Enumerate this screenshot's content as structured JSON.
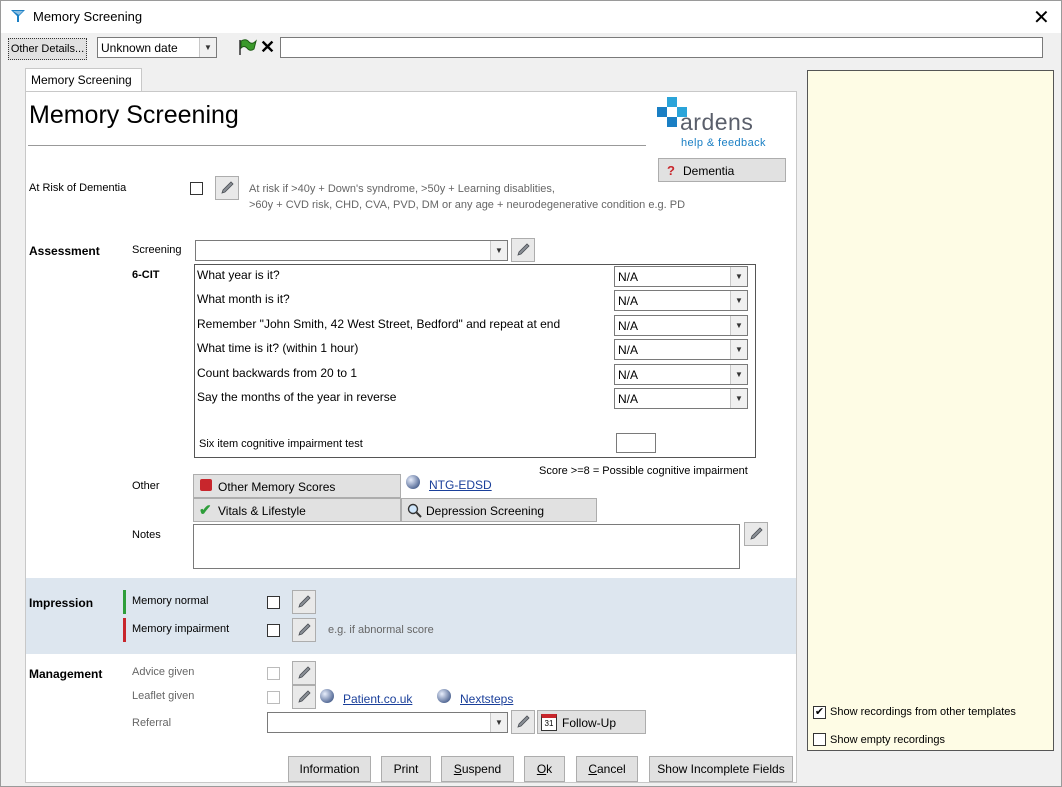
{
  "window": {
    "title": "Memory Screening",
    "close_glyph": "✕"
  },
  "toolbar": {
    "other_details_label": "Other Details...",
    "date_value": "Unknown date",
    "search_value": ""
  },
  "tab": {
    "label": "Memory Screening"
  },
  "heading": "Memory Screening",
  "brand": {
    "name": "ardens",
    "subtitle": "help & feedback",
    "dementia_button": "Dementia"
  },
  "risk": {
    "label": "At Risk of Dementia",
    "hint_line1": "At risk if >40y + Down's syndrome, >50y + Learning disablities,",
    "hint_line2": ">60y + CVD risk, CHD, CVA, PVD, DM or any age + neurodegenerative condition e.g. PD"
  },
  "assessment": {
    "section_label": "Assessment",
    "screening_label": "Screening",
    "screening_value": "",
    "cit_label": "6-CIT",
    "questions": [
      {
        "text": "What year is it?",
        "value": "N/A"
      },
      {
        "text": "What month is it?",
        "value": "N/A"
      },
      {
        "text": "Remember \"John Smith, 42 West Street, Bedford\" and repeat at end",
        "value": "N/A"
      },
      {
        "text": "What time is it? (within 1 hour)",
        "value": "N/A"
      },
      {
        "text": "Count backwards from 20 to 1",
        "value": "N/A"
      },
      {
        "text": "Say the months of the year in reverse",
        "value": "N/A"
      }
    ],
    "total_label": "Six item cognitive impairment test",
    "total_value": "",
    "score_note": "Score >=8   = Possible cognitive impairment",
    "other_label": "Other",
    "other_memory_scores": "Other Memory Scores",
    "ntg_link": "NTG-EDSD",
    "vitals_lifestyle": "Vitals & Lifestyle",
    "depression_screening": "Depression Screening",
    "notes_label": "Notes",
    "notes_value": ""
  },
  "impression": {
    "section_label": "Impression",
    "memory_normal": "Memory normal",
    "memory_impairment": "Memory impairment",
    "impairment_hint": "e.g. if abnormal score",
    "normal_color": "#2e9e3a",
    "impairment_color": "#c8262c"
  },
  "management": {
    "section_label": "Management",
    "advice_given": "Advice given",
    "leaflet_given": "Leaflet given",
    "patient_link": "Patient.co.uk",
    "nextsteps_link": "Nextsteps",
    "referral_label": "Referral",
    "referral_value": "",
    "follow_up": "Follow-Up",
    "calendar_day": "31"
  },
  "right_panel": {
    "show_other_templates": "Show recordings from other templates",
    "show_other_templates_checked": true,
    "show_empty": "Show empty recordings",
    "show_empty_checked": false
  },
  "footer": {
    "information": "Information",
    "print": "Print",
    "suspend": "Suspend",
    "ok": "Ok",
    "cancel": "Cancel",
    "show_incomplete": "Show Incomplete Fields"
  },
  "colors": {
    "accent_blue": "#1a7fc4",
    "impression_band": "#dde6ef"
  }
}
